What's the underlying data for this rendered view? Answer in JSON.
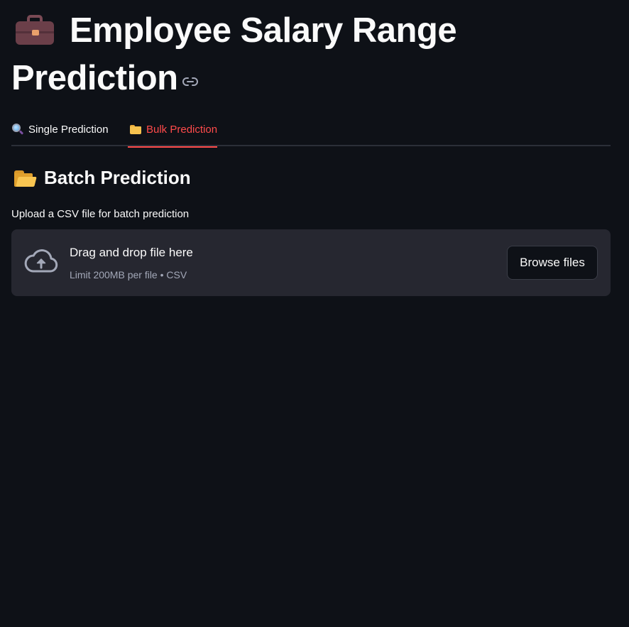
{
  "header": {
    "title_line1": "Employee Salary Range",
    "title_line2": "Prediction",
    "title_icon": "briefcase-icon",
    "anchor_icon": "link-icon"
  },
  "tabs": [
    {
      "label": "Single Prediction",
      "icon": "magnifying-glass-icon",
      "active": false
    },
    {
      "label": "Bulk Prediction",
      "icon": "folder-icon",
      "active": true
    }
  ],
  "section": {
    "title": "Batch Prediction",
    "icon": "open-folder-icon"
  },
  "uploader": {
    "label": "Upload a CSV file for batch prediction",
    "drop_text": "Drag and drop file here",
    "limit_text": "Limit 200MB per file • CSV",
    "browse_label": "Browse files",
    "icon": "cloud-upload-icon"
  },
  "colors": {
    "background": "#0e1117",
    "accent": "#ff4b4b",
    "dropzone_bg": "#262730"
  }
}
